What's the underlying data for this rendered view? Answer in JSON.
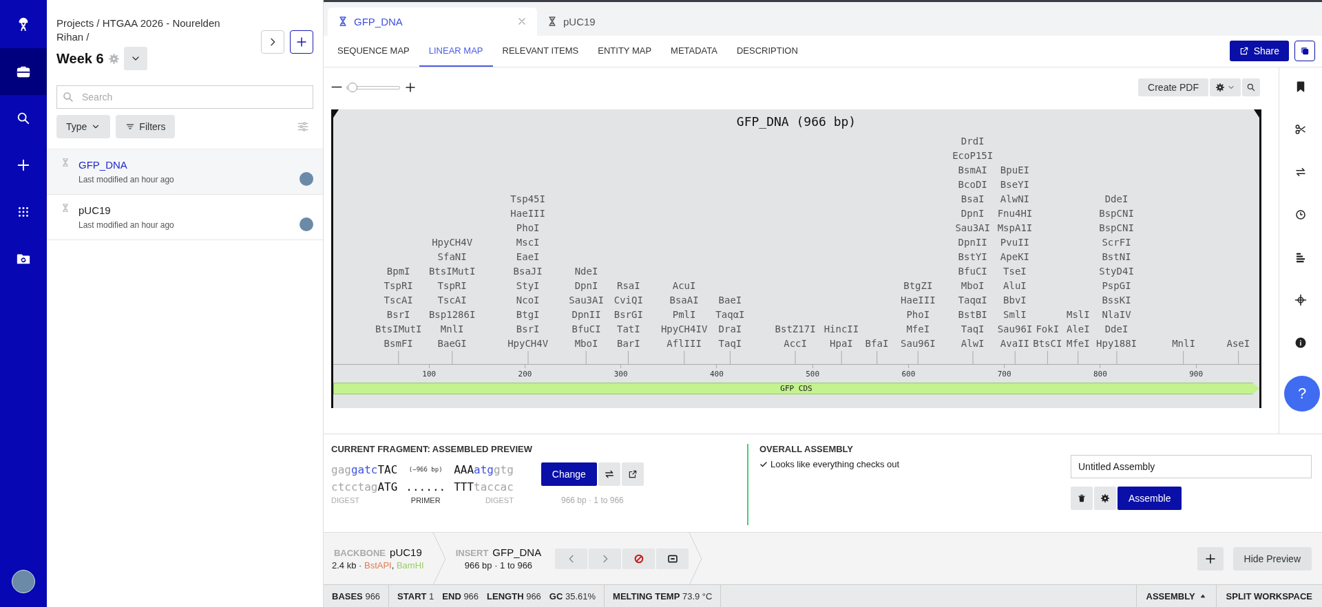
{
  "rail": [
    {
      "kind": "logo",
      "selected": false
    },
    {
      "kind": "briefcase",
      "selected": true
    },
    {
      "kind": "search",
      "selected": false
    },
    {
      "kind": "plus",
      "selected": false
    },
    {
      "kind": "apps",
      "selected": false
    },
    {
      "kind": "folder",
      "selected": false
    }
  ],
  "sidebar": {
    "breadcrumb": "Projects / HTGAA 2026 - Nourelden Rihan /",
    "title": "Week 6",
    "search": {
      "placeholder": "Search"
    },
    "type_label": "Type",
    "filters_label": "Filters",
    "items": [
      {
        "name": "GFP_DNA",
        "subtitle": "Last modified an hour ago",
        "selected": true
      },
      {
        "name": "pUC19",
        "subtitle": "Last modified an hour ago",
        "selected": false
      }
    ]
  },
  "doc_tabs": [
    {
      "label": "GFP_DNA",
      "selected": true
    },
    {
      "label": "pUC19",
      "selected": false
    }
  ],
  "view_tabs": [
    {
      "label": "SEQUENCE MAP",
      "selected": false
    },
    {
      "label": "LINEAR MAP",
      "selected": true
    },
    {
      "label": "RELEVANT ITEMS",
      "selected": false
    },
    {
      "label": "ENTITY MAP",
      "selected": false
    },
    {
      "label": "METADATA",
      "selected": false
    },
    {
      "label": "DESCRIPTION",
      "selected": false
    }
  ],
  "share_label": "Share",
  "toolbar": {
    "zoom": {
      "level": 0.12
    },
    "create_pdf": "Create PDF"
  },
  "map": {
    "title": "GFP_DNA (966 bp)",
    "sites": [
      {
        "labels": [
          "BpmI",
          "TspRI",
          "TscAI",
          "BsrI",
          "BtsIMutI",
          "BsmFI"
        ]
      },
      {
        "labels": [
          "HpyCH4V",
          "SfaNI",
          "BtsIMutI",
          "TspRI",
          "TscAI",
          "Bsp1286I",
          "MnlI",
          "BaeGI"
        ]
      },
      {
        "labels": [
          "Tsp45I",
          "HaeIII",
          "PhoI",
          "MscI",
          "EaeI",
          "BsaJI",
          "StyI",
          "NcoI",
          "BtgI",
          "BsrI",
          "HpyCH4V"
        ]
      },
      {
        "labels": [
          "NdeI",
          "DpnI",
          "Sau3AI",
          "DpnII",
          "BfuCI",
          "MboI"
        ]
      },
      {
        "labels": [
          "RsaI",
          "CviQI",
          "BsrGI",
          "TatI",
          "BarI"
        ]
      },
      {
        "labels": [
          "AcuI",
          "BsaAI",
          "PmlI",
          "HpyCH4IV",
          "AflIII"
        ]
      },
      {
        "labels": [
          "BaeI",
          "TaqαI",
          "DraI",
          "TaqI"
        ]
      },
      {
        "labels": [
          "BstZ17I",
          "AccI"
        ]
      },
      {
        "labels": [
          "HincII",
          "HpaI"
        ]
      },
      {
        "labels": [
          "BfaI"
        ]
      },
      {
        "labels": [
          "BtgZI",
          "HaeIII",
          "PhoI",
          "MfeI",
          "Sau96I"
        ]
      },
      {
        "labels": [
          "DrdI",
          "EcoP15I",
          "BsmAI",
          "BcoDI",
          "BsaI",
          "DpnI",
          "Sau3AI",
          "DpnII",
          "BstYI",
          "BfuCI",
          "MboI",
          "TaqαI",
          "BstBI",
          "TaqI",
          "AlwI"
        ]
      },
      {
        "labels": [
          "BpuEI",
          "BseYI",
          "AlwNI",
          "Fnu4HI",
          "MspA1I",
          "PvuII",
          "ApeKI",
          "TseI",
          "AluI",
          "BbvI",
          "SmlI",
          "Sau96I",
          "AvaII"
        ]
      },
      {
        "labels": [
          "FokI",
          "BtsCI"
        ]
      },
      {
        "labels": [
          "MslI",
          "AleI",
          "MfeI"
        ]
      },
      {
        "labels": [
          "DdeI",
          "BspCNI",
          "BspCNI",
          "ScrFI",
          "BstNI",
          "StyD4I",
          "PspGI",
          "BssKI",
          "NlaIV",
          "DdeI",
          "Hpy188I"
        ]
      },
      {
        "labels": [
          "MnlI"
        ]
      },
      {
        "labels": [
          "AseI"
        ]
      }
    ],
    "ticks": [
      "100",
      "200",
      "300",
      "400",
      "500",
      "600",
      "700",
      "800",
      "900"
    ],
    "feature": "GFP CDS"
  },
  "right_rail": [
    {
      "kind": "bookmark"
    },
    {
      "kind": "scissors"
    },
    {
      "kind": "swap"
    },
    {
      "kind": "clock"
    },
    {
      "kind": "lines"
    },
    {
      "kind": "crosshair"
    },
    {
      "kind": "info"
    }
  ],
  "help_label": "?",
  "preview": {
    "title": "CURRENT FRAGMENT: ASSEMBLED PREVIEW",
    "left_top": [
      {
        "text": "gag",
        "muted": true,
        "site": false
      },
      {
        "text": "gatc",
        "muted": false,
        "site": true
      },
      {
        "text": "TAC",
        "muted": false,
        "site": false
      }
    ],
    "left_bottom": [
      {
        "text": "ctcctag",
        "muted": true,
        "site": false
      },
      {
        "text": "ATG",
        "muted": false,
        "site": false
      }
    ],
    "left_caption": "DIGEST",
    "middle_top": "(−966 bp)",
    "middle_bottom": "......",
    "middle_caption": "PRIMER",
    "right_top": [
      {
        "text": "AAA",
        "muted": false,
        "site": false
      },
      {
        "text": "atg",
        "muted": false,
        "site": true
      },
      {
        "text": "gtg",
        "muted": true,
        "site": false
      }
    ],
    "right_bottom": [
      {
        "text": "TTT",
        "muted": false,
        "site": false
      },
      {
        "text": "taccac",
        "muted": true,
        "site": false
      }
    ],
    "right_caption": "DIGEST",
    "change_label": "Change",
    "range": "966 bp · 1 to 966"
  },
  "overall": {
    "title": "OVERALL ASSEMBLY",
    "status": "Looks like everything checks out",
    "name_value": "Untitled Assembly",
    "assemble_label": "Assemble"
  },
  "fragments": {
    "backbone": {
      "tag": "BACKBONE",
      "name": "pUC19",
      "detail": [
        {
          "text": "2.4 kb · "
        },
        {
          "text": "BstAPI",
          "color": "#e07a52"
        },
        {
          "text": ", "
        },
        {
          "text": "BamHI",
          "color": "#9ccc65"
        }
      ]
    },
    "insert": {
      "tag": "INSERT",
      "name": "GFP_DNA",
      "detail": "966 bp · 1 to 966"
    },
    "hide_label": "Hide Preview"
  },
  "status_bar": {
    "groups": [
      {
        "items": [
          {
            "label": "BASES",
            "value": "966"
          }
        ]
      },
      {
        "items": [
          {
            "label": "START",
            "value": "1"
          },
          {
            "label": "END",
            "value": "966"
          },
          {
            "label": "LENGTH",
            "value": "966"
          },
          {
            "label": "GC",
            "value": "35.61%"
          }
        ]
      },
      {
        "items": [
          {
            "label": "MELTING TEMP",
            "value": "73.9 °C"
          }
        ]
      }
    ],
    "right": [
      {
        "label": "ASSEMBLY",
        "dropdown": true
      },
      {
        "label": "SPLIT WORKSPACE",
        "dropdown": false
      }
    ]
  }
}
